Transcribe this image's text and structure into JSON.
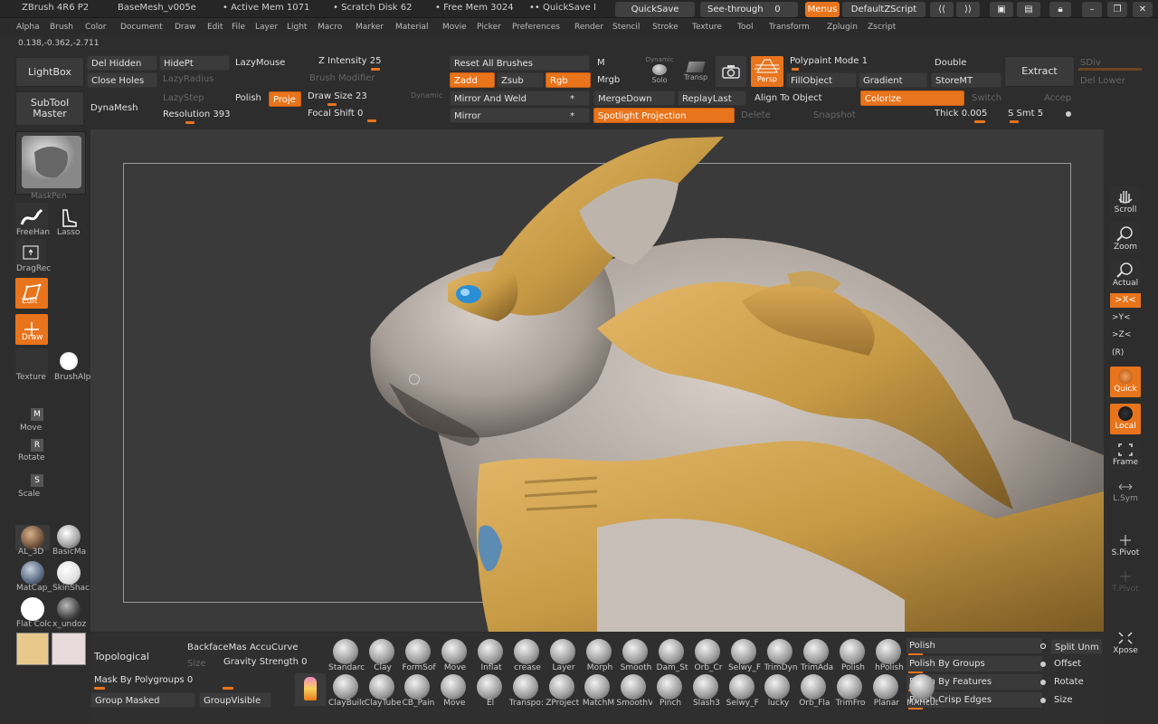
{
  "titlebar": {
    "app": "ZBrush 4R6 P2",
    "doc": "BaseMesh_v005e",
    "active_mem": "Active Mem 1071",
    "scratch": "Scratch Disk 62",
    "free_mem": "Free Mem 3024",
    "quicksave_hint": "QuickSave I",
    "quicksave": "QuickSave",
    "see_through": "See-through",
    "see_through_val": "0",
    "menus": "Menus",
    "script": "DefaultZScript"
  },
  "menu": [
    "Alpha",
    "Brush",
    "Color",
    "Document",
    "Draw",
    "Edit",
    "File",
    "Layer",
    "Light",
    "Macro",
    "Marker",
    "Material",
    "Movie",
    "Picker",
    "Preferences",
    "Render",
    "Stencil",
    "Stroke",
    "Texture",
    "Tool",
    "Transform",
    "Zplugin",
    "Zscript"
  ],
  "coords": "0.138,-0.362,-2.711",
  "top": {
    "lightbox": "LightBox",
    "subtool_master": "SubTool Master",
    "del_hidden": "Del Hidden",
    "close_holes": "Close Holes",
    "dynamesh": "DynaMesh",
    "hidept": "HidePt",
    "lazymouse": "LazyMouse",
    "lazyradius": "LazyRadius",
    "lazystep": "LazyStep",
    "polish": "Polish",
    "project": "Proje",
    "resolution": "Resolution 393",
    "z_intensity": "Z Intensity 25",
    "brush_modifier": "Brush Modifier",
    "draw_size": "Draw Size 23",
    "dynamic": "Dynamic",
    "focal_shift": "Focal Shift 0",
    "reset_brushes": "Reset All Brushes",
    "zadd": "Zadd",
    "zsub": "Zsub",
    "rgb": "Rgb",
    "mirror_weld": "Mirror And Weld",
    "mirror": "Mirror",
    "m": "M",
    "mrgb": "Mrgb",
    "dynamic2": "Dynamic",
    "solo": "Solo",
    "transp": "Transp",
    "persp": "Persp",
    "mergedown": "MergeDown",
    "replaylast": "ReplayLast",
    "spotlight": "Spotlight Projection",
    "delete": "Delete",
    "snapshot": "Snapshot",
    "polypaint": "Polypaint Mode 1",
    "fillobject": "FillObject",
    "gradient": "Gradient",
    "align": "Align To Object",
    "colorize": "Colorize",
    "switch": "Switch",
    "accept": "Accep",
    "double": "Double",
    "storemt": "StoreMT",
    "extract": "Extract",
    "thick": "Thick",
    "thick_val": "0.005",
    "ssmt": "S Smt 5",
    "sdiv": "SDiv",
    "del_lower": "Del Lower"
  },
  "left": {
    "maskpen": "MaskPen",
    "freehand": "FreeHan",
    "lasso": "Lasso",
    "dragrect": "DragRec",
    "edit": "Edit",
    "draw": "Draw",
    "texture": "Texture",
    "brushalpha": "BrushAlp",
    "move": "Move",
    "rotate": "Rotate",
    "scale": "Scale",
    "materials": [
      {
        "label": "AL_3D"
      },
      {
        "label": "BasicMa"
      },
      {
        "label": "MatCap_"
      },
      {
        "label": "SkinShac"
      },
      {
        "label": "Flat Colc"
      },
      {
        "label": "x_undoz"
      }
    ],
    "mat_keys": {
      "move": "M",
      "rotate": "R",
      "scale": "S"
    }
  },
  "right": {
    "scroll": "Scroll",
    "zoom": "Zoom",
    "actual": "Actual",
    "x": ">X<",
    "y": ">Y<",
    "z": ">Z<",
    "r": "(R)",
    "quick": "Quick",
    "local": "Local",
    "frame": "Frame",
    "lsym": "L.Sym",
    "spivot": "S.Pivot",
    "tpivot": "T.Pivot",
    "xpose": "Xpose"
  },
  "bottom": {
    "topological": "Topological",
    "backface": "BackfaceMas",
    "accucurve": "AccuCurve",
    "size": "Size",
    "gravity": "Gravity Strength 0",
    "mask_polygroups": "Mask By Polygroups 0",
    "group_masked": "Group Masked",
    "group_visible": "GroupVisible",
    "brushes_row1": [
      "Standarc",
      "Clay",
      "FormSof",
      "Move",
      "Inflat",
      "crease",
      "Layer",
      "Morph",
      "Smooth",
      "Dam_St",
      "Orb_Cr",
      "Selwy_F",
      "TrimDyn",
      "TrimAda",
      "Polish",
      "hPolish"
    ],
    "brushes_row2": [
      "ClayBuilc",
      "ClayTube",
      "CB_Pain",
      "Move",
      "El",
      "Transpo:",
      "ZProject",
      "MatchM",
      "SmoothV",
      "Pinch",
      "Slash3",
      "Selwy_F",
      "lucky",
      "Orb_Fla",
      "TrimFro",
      "Planar",
      "MAHcut"
    ],
    "polish": "Polish",
    "polish_groups": "Polish By Groups",
    "polish_features": "Polish By Features",
    "polish_crisp": "Polish Crisp Edges",
    "split": "Split Unm",
    "offset": "Offset",
    "rotate": "Rotate",
    "size2": "Size"
  },
  "colors": {
    "accent": "#e8741c",
    "swatch_main": "#e9c98b",
    "swatch_secondary": "#e8dada"
  }
}
